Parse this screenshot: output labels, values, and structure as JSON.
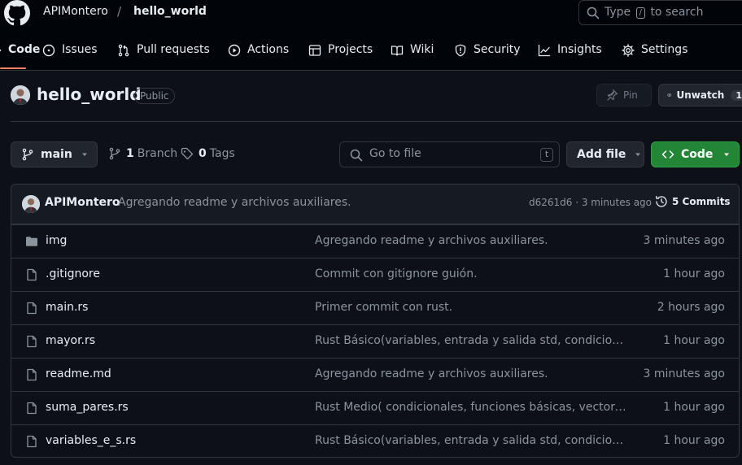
{
  "header": {
    "owner": "APIMontero",
    "separator": "/",
    "repo": "hello_world",
    "search": {
      "prefix": "Type",
      "key": "/",
      "suffix": "to search"
    }
  },
  "nav": [
    {
      "label": "Code",
      "icon": "code-icon",
      "active": true
    },
    {
      "label": "Issues",
      "icon": "issue-opened-icon"
    },
    {
      "label": "Pull requests",
      "icon": "git-pull-request-icon"
    },
    {
      "label": "Actions",
      "icon": "play-icon"
    },
    {
      "label": "Projects",
      "icon": "table-icon"
    },
    {
      "label": "Wiki",
      "icon": "book-icon"
    },
    {
      "label": "Security",
      "icon": "shield-icon"
    },
    {
      "label": "Insights",
      "icon": "graph-icon"
    },
    {
      "label": "Settings",
      "icon": "gear-icon"
    }
  ],
  "repo": {
    "name": "hello_world",
    "visibility": "Public",
    "pin_label": "Pin",
    "unwatch_label": "Unwatch",
    "watch_count": "1"
  },
  "toolbar": {
    "branch": "main",
    "branch_count": "1",
    "branch_label": "Branch",
    "tag_count": "0",
    "tag_label": "Tags",
    "goto_placeholder": "Go to file",
    "goto_key": "t",
    "add_file_label": "Add file",
    "code_label": "Code"
  },
  "latest_commit": {
    "author": "APIMontero",
    "message": "Agregando readme y archivos auxiliares.",
    "meta": "d6261d6 · 3 minutes ago",
    "commits_label": "5 Commits"
  },
  "files": [
    {
      "type": "folder",
      "icon": "file-directory-icon",
      "name": "img",
      "message": "Agregando readme y archivos auxiliares.",
      "time": "3 minutes ago"
    },
    {
      "type": "file",
      "icon": "file-icon",
      "name": ".gitignore",
      "message": "Commit con gitignore guión.",
      "time": "1 hour ago"
    },
    {
      "type": "file",
      "icon": "file-icon",
      "name": "main.rs",
      "message": "Primer commit con rust.",
      "time": "2 hours ago"
    },
    {
      "type": "file",
      "icon": "file-icon",
      "name": "mayor.rs",
      "message": "Rust Básico(variables, entrada y salida std, condicionales…",
      "time": "1 hour ago"
    },
    {
      "type": "file",
      "icon": "file-icon",
      "name": "readme.md",
      "message": "Agregando readme y archivos auxiliares.",
      "time": "3 minutes ago"
    },
    {
      "type": "file",
      "icon": "file-icon",
      "name": "suma_pares.rs",
      "message": "Rust Medio( condicionales, funciones básicas, vectores. E…",
      "time": "1 hour ago"
    },
    {
      "type": "file",
      "icon": "file-icon",
      "name": "variables_e_s.rs",
      "message": "Rust Básico(variables, entrada y salida std, condicionales…",
      "time": "1 hour ago"
    }
  ],
  "colors": {
    "background": "#0d1117",
    "header_bg": "#010409",
    "border": "#30363d",
    "text": "#e6edf3",
    "muted": "#8b949e",
    "accent_underline": "#f78166",
    "code_button": "#238636"
  }
}
